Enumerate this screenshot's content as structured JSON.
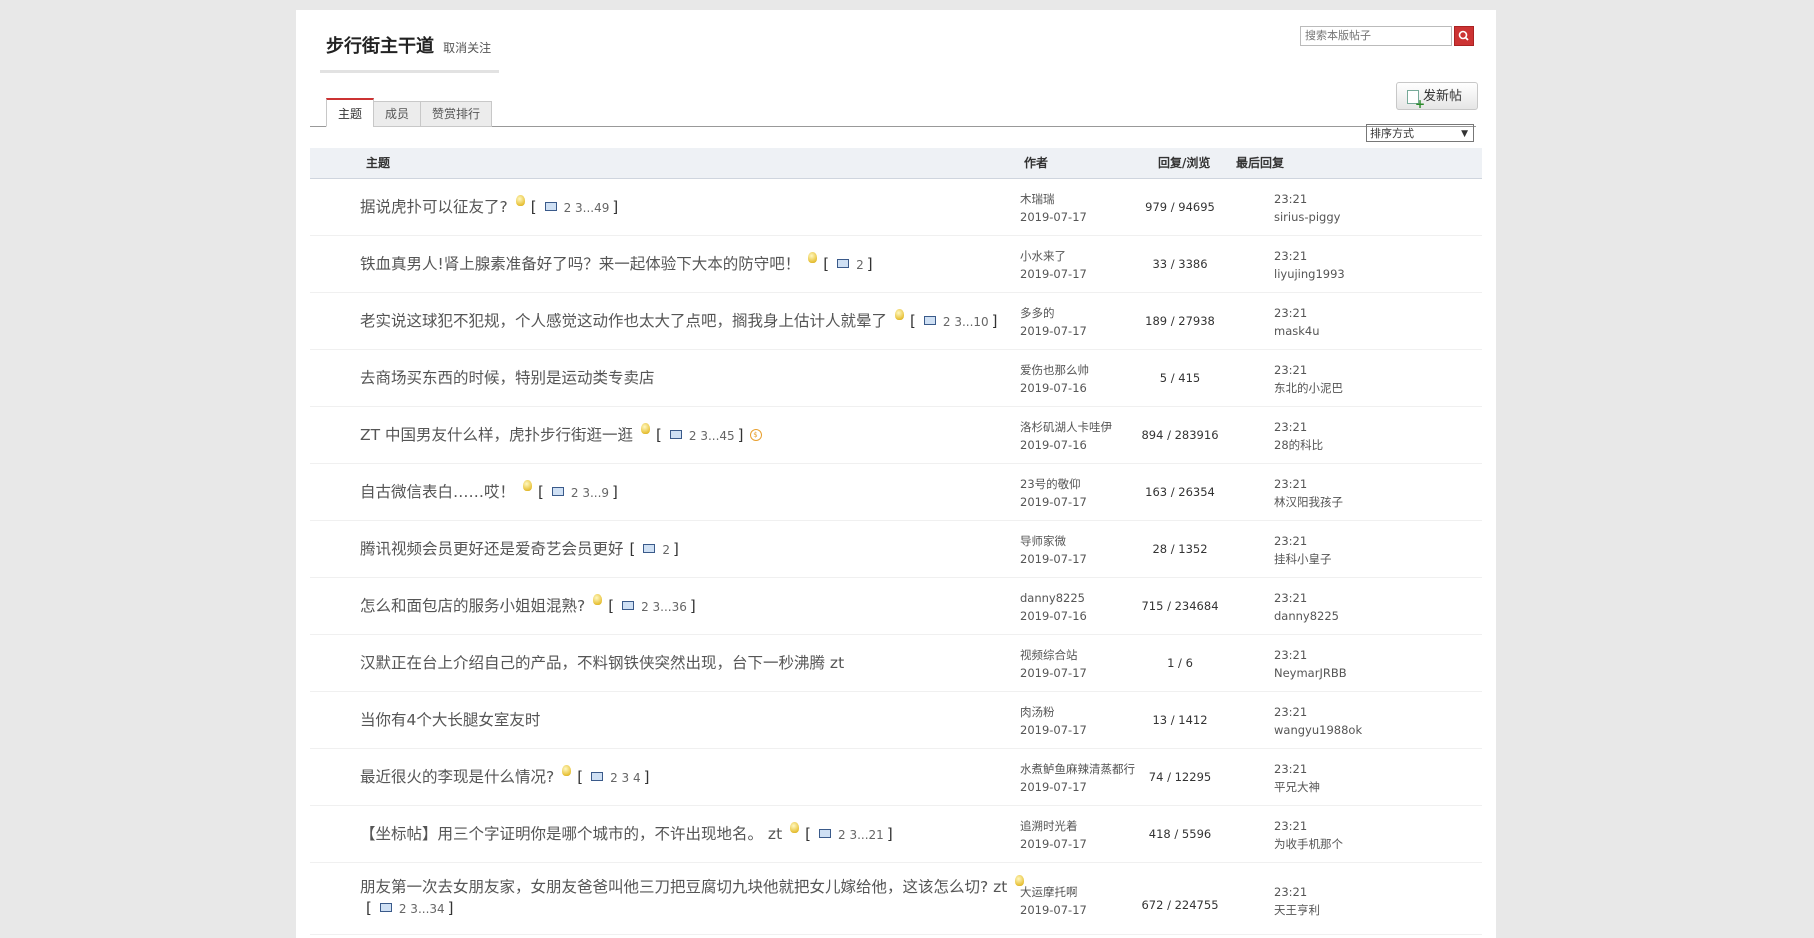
{
  "board": {
    "title": "步行街主干道",
    "unfollow": "取消关注"
  },
  "search": {
    "placeholder": "搜索本版帖子"
  },
  "tabs": [
    "主题",
    "成员",
    "赞赏排行"
  ],
  "new_post": "发新帖",
  "sort_label": "排序方式",
  "columns": {
    "topic": "主题",
    "author": "作者",
    "counts": "回复/浏览",
    "last": "最后回复"
  },
  "threads": [
    {
      "title": "据说虎扑可以征友了?",
      "bulb": true,
      "pages": "2 3...49",
      "author": "木瑞瑞",
      "date": "2019-07-17",
      "counts": "979 / 94695",
      "last_time": "23:21",
      "last_user": "sirius-piggy"
    },
    {
      "title": "铁血真男人!肾上腺素准备好了吗？来一起体验下大本的防守吧！",
      "bulb": true,
      "pages": "2",
      "author": "小水来了",
      "date": "2019-07-17",
      "counts": "33 / 3386",
      "last_time": "23:21",
      "last_user": "liyujing1993"
    },
    {
      "title": "老实说这球犯不犯规，个人感觉这动作也太大了点吧，搁我身上估计人就晕了",
      "bulb": true,
      "pages": "2 3...10",
      "author": "多多的",
      "date": "2019-07-17",
      "counts": "189 / 27938",
      "last_time": "23:21",
      "last_user": "mask4u"
    },
    {
      "title": "去商场买东西的时候，特别是运动类专卖店",
      "bulb": false,
      "pages": "",
      "author": "爱伤也那么帅",
      "date": "2019-07-16",
      "counts": "5 / 415",
      "last_time": "23:21",
      "last_user": "东北的小泥巴"
    },
    {
      "title": "ZT 中国男友什么样，虎扑步行街逛一逛",
      "bulb": true,
      "pages": "2 3...45",
      "coin": "$",
      "author": "洛杉矶湖人卡哇伊",
      "date": "2019-07-16",
      "counts": "894 / 283916",
      "last_time": "23:21",
      "last_user": "28的科比"
    },
    {
      "title": "自古微信表白……哎！",
      "bulb": true,
      "pages": "2 3...9",
      "author": "23号的敬仰",
      "date": "2019-07-17",
      "counts": "163 / 26354",
      "last_time": "23:21",
      "last_user": "林汉阳我孩子"
    },
    {
      "title": "腾讯视频会员更好还是爱奇艺会员更好",
      "bulb": false,
      "pages": "2",
      "author": "导师家微",
      "date": "2019-07-17",
      "counts": "28 / 1352",
      "last_time": "23:21",
      "last_user": "挂科小皇子"
    },
    {
      "title": "怎么和面包店的服务小姐姐混熟?",
      "bulb": true,
      "pages": "2 3...36",
      "author": "danny8225",
      "date": "2019-07-16",
      "counts": "715 / 234684",
      "last_time": "23:21",
      "last_user": "danny8225"
    },
    {
      "title": "汉默正在台上介绍自己的产品，不料钢铁侠突然出现，台下一秒沸腾 zt",
      "bulb": false,
      "pages": "",
      "author": "视频综合站",
      "date": "2019-07-17",
      "counts": "1 / 6",
      "last_time": "23:21",
      "last_user": "NeymarJRBB"
    },
    {
      "title": "当你有4个大长腿女室友时",
      "bulb": false,
      "pages": "",
      "author": "肉汤粉",
      "date": "2019-07-17",
      "counts": "13 / 1412",
      "last_time": "23:21",
      "last_user": "wangyu1988ok"
    },
    {
      "title": "最近很火的李现是什么情况?",
      "bulb": true,
      "pages": "2 3 4",
      "author": "水煮鲈鱼麻辣清蒸都行",
      "date": "2019-07-17",
      "counts": "74 / 12295",
      "last_time": "23:21",
      "last_user": "平兄大神"
    },
    {
      "title": "【坐标帖】用三个字证明你是哪个城市的，不许出现地名。 zt",
      "bulb": true,
      "pages": "2 3...21",
      "author": "追溯时光着",
      "date": "2019-07-17",
      "counts": "418 / 5596",
      "last_time": "23:21",
      "last_user": "为收手机那个"
    },
    {
      "title": "朋友第一次去女朋友家，女朋友爸爸叫他三刀把豆腐切九块他就把女儿嫁给他，这该怎么切? zt",
      "bulb": true,
      "pages": "2 3...34",
      "author": "大运摩托啊",
      "date": "2019-07-17",
      "counts": "672 / 224755",
      "last_time": "23:21",
      "last_user": "天王亨利"
    }
  ]
}
